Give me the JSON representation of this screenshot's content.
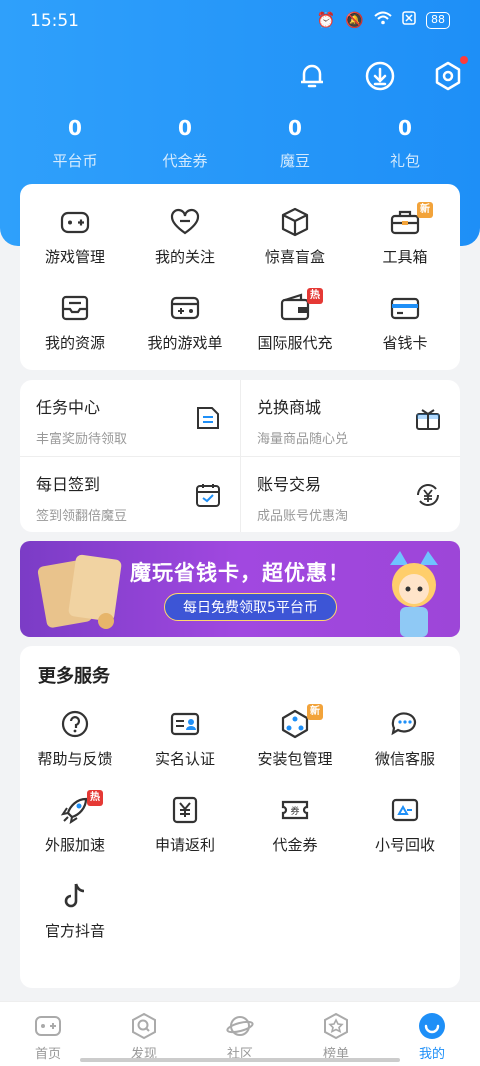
{
  "status": {
    "time": "15:51",
    "battery": "88"
  },
  "stats": [
    {
      "value": "0",
      "label": "平台币"
    },
    {
      "value": "0",
      "label": "代金券"
    },
    {
      "value": "0",
      "label": "魔豆"
    },
    {
      "value": "0",
      "label": "礼包"
    }
  ],
  "tools": [
    {
      "label": "游戏管理",
      "icon": "gamepad-icon"
    },
    {
      "label": "我的关注",
      "icon": "heart-icon"
    },
    {
      "label": "惊喜盲盒",
      "icon": "box-icon"
    },
    {
      "label": "工具箱",
      "icon": "toolbox-icon",
      "badge": "新"
    },
    {
      "label": "我的资源",
      "icon": "resource-icon"
    },
    {
      "label": "我的游戏单",
      "icon": "game-list-icon"
    },
    {
      "label": "国际服代充",
      "icon": "wallet-icon",
      "badge": "热"
    },
    {
      "label": "省钱卡",
      "icon": "card-icon"
    }
  ],
  "tasks": [
    {
      "title": "任务中心",
      "subtitle": "丰富奖励待领取"
    },
    {
      "title": "兑换商城",
      "subtitle": "海量商品随心兑"
    },
    {
      "title": "每日签到",
      "subtitle": "签到领翻倍魔豆"
    },
    {
      "title": "账号交易",
      "subtitle": "成品账号优惠淘"
    }
  ],
  "banner": {
    "title": "魔玩省钱卡，超优惠！",
    "pill": "每日免费领取5平台币"
  },
  "more": {
    "title": "更多服务",
    "items": [
      {
        "label": "帮助与反馈"
      },
      {
        "label": "实名认证"
      },
      {
        "label": "安装包管理",
        "badge": "新"
      },
      {
        "label": "微信客服"
      },
      {
        "label": "外服加速",
        "badge": "热"
      },
      {
        "label": "申请返利"
      },
      {
        "label": "代金券"
      },
      {
        "label": "小号回收"
      },
      {
        "label": "官方抖音"
      }
    ]
  },
  "tabs": [
    {
      "label": "首页"
    },
    {
      "label": "发现"
    },
    {
      "label": "社区"
    },
    {
      "label": "榜单"
    },
    {
      "label": "我的"
    }
  ],
  "colors": {
    "primary": "#1e8ff7",
    "badge_new": "#f2a33a",
    "badge_hot": "#e53935"
  }
}
